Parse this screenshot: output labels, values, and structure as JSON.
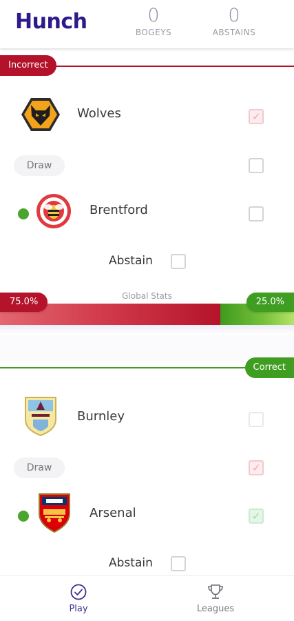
{
  "app": {
    "title": "Hunch",
    "brand_color": "#2f1a8a"
  },
  "header": {
    "stats": [
      {
        "value": "0",
        "label": "BOGEYS"
      },
      {
        "value": "0",
        "label": "ABSTAINS"
      }
    ]
  },
  "matches": [
    {
      "result": "Incorrect",
      "result_color": "#b3122a",
      "home": {
        "name": "Wolves",
        "logo_icon": "wolves-crest-icon",
        "checked": true
      },
      "draw": {
        "label": "Draw",
        "checked": false
      },
      "away": {
        "name": "Brentford",
        "logo_icon": "brentford-crest-icon",
        "checked": false,
        "indicator": true
      },
      "abstain": {
        "label": "Abstain",
        "checked": false
      }
    },
    {
      "result": "Correct",
      "result_color": "#3f9d22",
      "home": {
        "name": "Burnley",
        "logo_icon": "burnley-crest-icon",
        "checked": false
      },
      "draw": {
        "label": "Draw",
        "checked": true
      },
      "away": {
        "name": "Arsenal",
        "logo_icon": "arsenal-crest-icon",
        "checked": true,
        "indicator": true
      },
      "abstain": {
        "label": "Abstain",
        "checked": false
      }
    }
  ],
  "global_stats": {
    "label": "Global Stats",
    "left_label": "75.0%",
    "right_label": "25.0%",
    "left_fraction": 0.75,
    "right_fraction": 0.25
  },
  "bottom_nav": {
    "items": [
      {
        "label": "Play",
        "icon": "check-circle-icon",
        "active": true
      },
      {
        "label": "Leagues",
        "icon": "trophy-icon",
        "active": false
      }
    ]
  }
}
